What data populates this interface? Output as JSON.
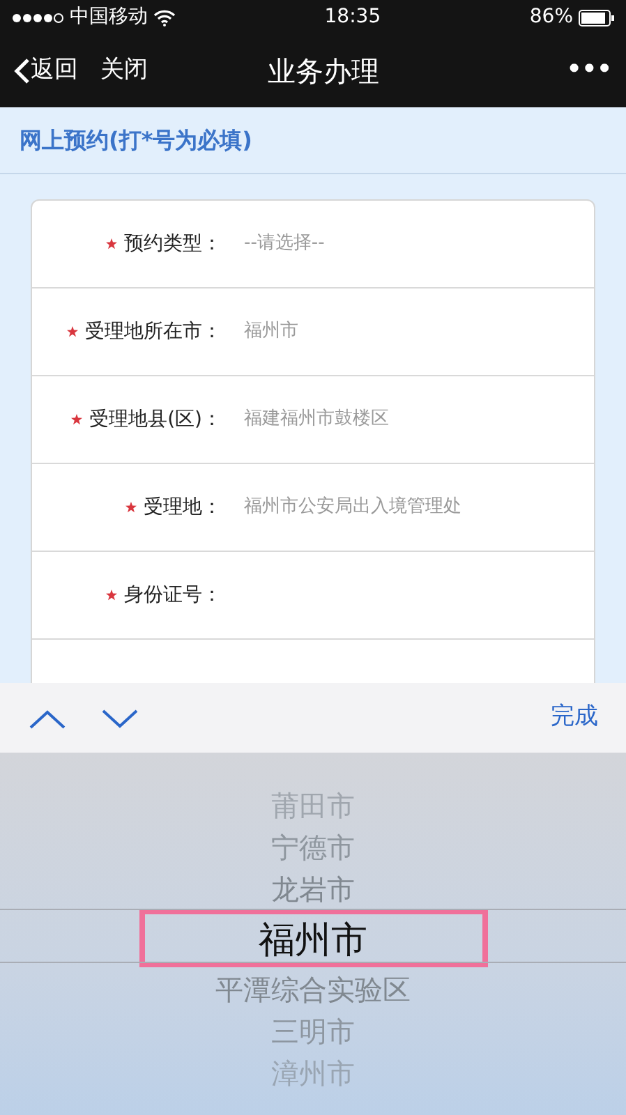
{
  "status_bar": {
    "carrier": "中国移动",
    "time": "18:35",
    "battery": "86%"
  },
  "nav": {
    "back": "返回",
    "close": "关闭",
    "title": "业务办理",
    "more": "•••"
  },
  "section_title": "网上预约(打*号为必填)",
  "form": [
    {
      "label": "预约类型：",
      "required": true,
      "value": "--请选择--"
    },
    {
      "label": "受理地所在市：",
      "required": true,
      "value": "福州市"
    },
    {
      "label": "受理地县(区)：",
      "required": true,
      "value": "福建福州市鼓楼区"
    },
    {
      "label": "受理地：",
      "required": true,
      "value": "福州市公安局出入境管理处"
    },
    {
      "label": "身份证号：",
      "required": true
    }
  ],
  "toolbar": {
    "done": "完成"
  },
  "picker": [
    {
      "label": "莆田市",
      "selected": false
    },
    {
      "label": "宁德市",
      "selected": false
    },
    {
      "label": "龙岩市",
      "selected": false
    },
    {
      "label": "福州市",
      "selected": true
    },
    {
      "label": "平潭综合实验区",
      "selected": false
    },
    {
      "label": "三明市",
      "selected": false
    },
    {
      "label": "漳州市",
      "selected": false
    }
  ]
}
